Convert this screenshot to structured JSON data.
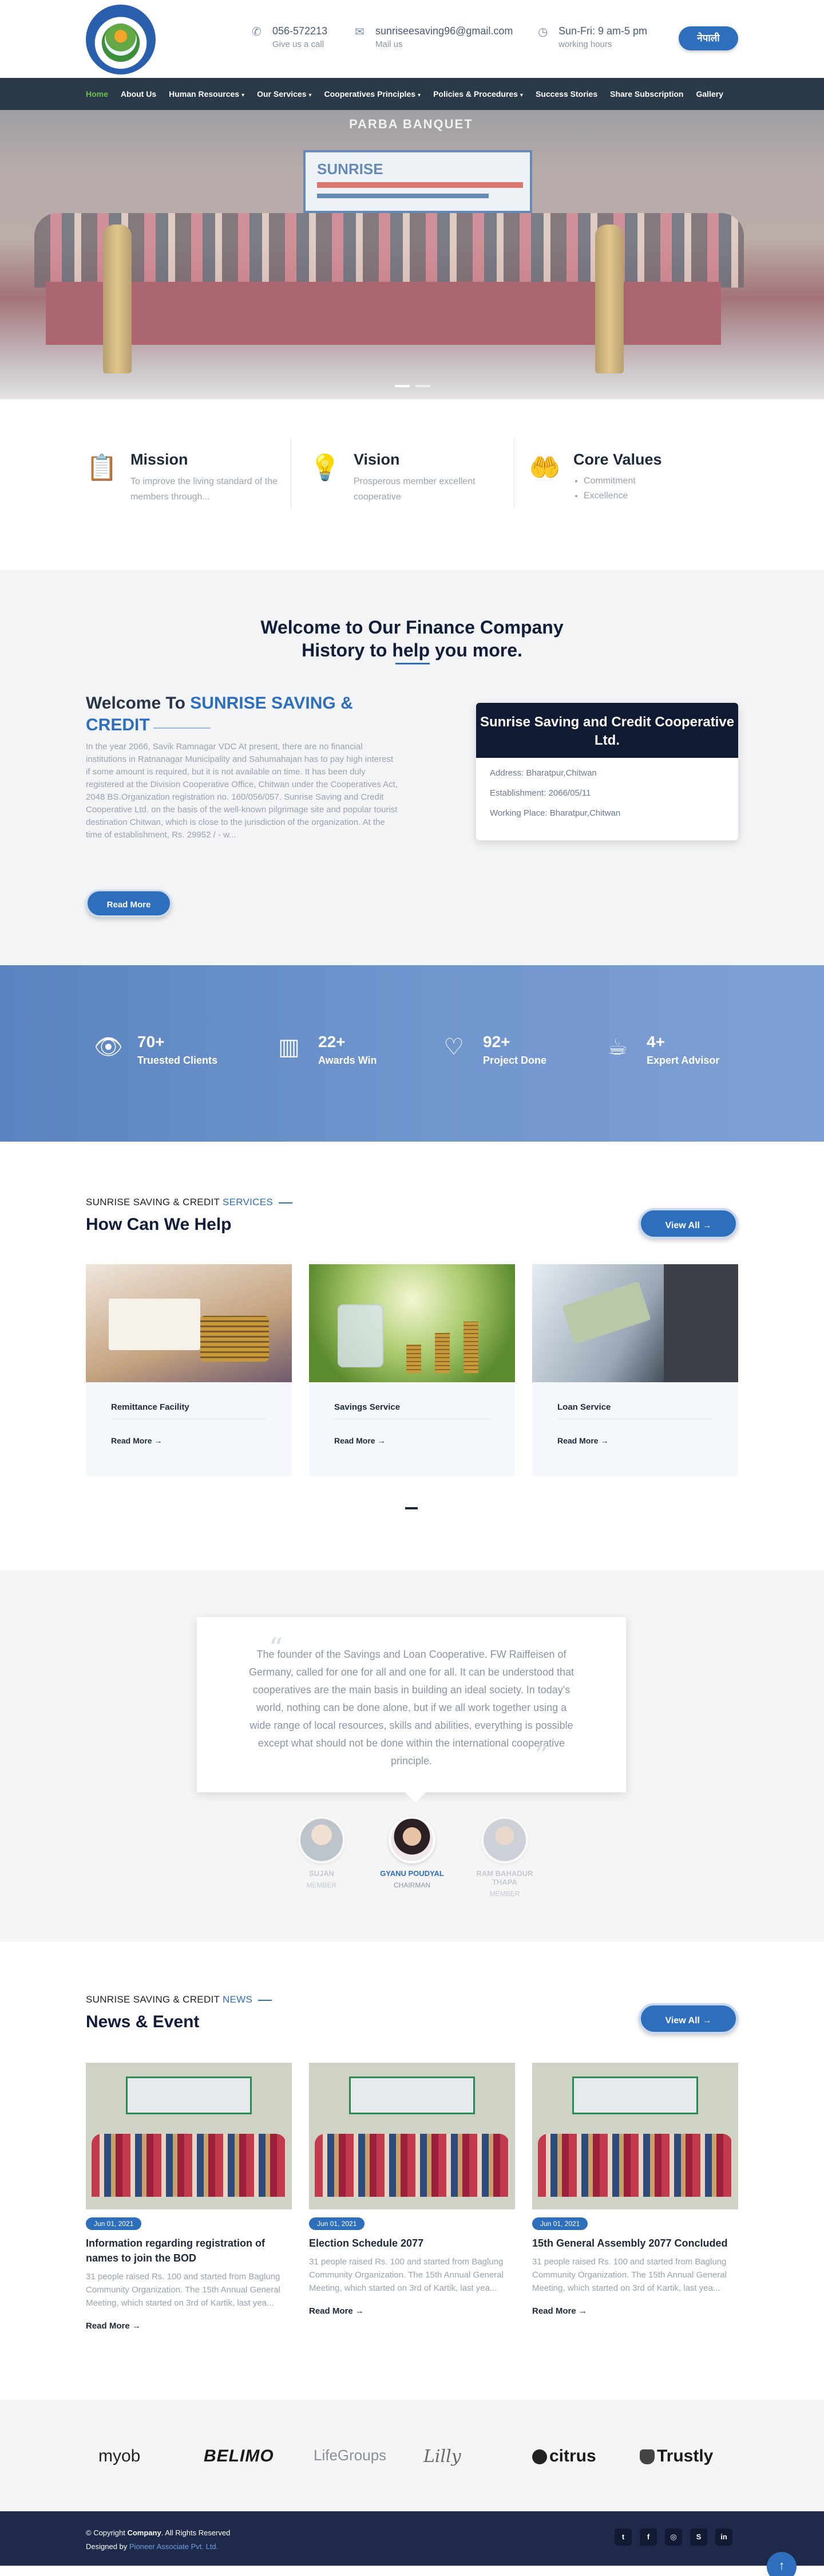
{
  "header": {
    "phone": {
      "icon": "phone-icon",
      "title": "056-572213",
      "sub": "Give us a call"
    },
    "email": {
      "icon": "mail-icon",
      "title": "sunriseesaving96@gmail.com",
      "sub": "Mail us"
    },
    "hours": {
      "icon": "clock-icon",
      "title": "Sun-Fri: 9 am-5 pm",
      "sub": "working hours"
    },
    "lang_button": "नेपाली"
  },
  "nav": {
    "items": [
      {
        "label": "Home",
        "dropdown": false,
        "active": true
      },
      {
        "label": "About Us",
        "dropdown": false
      },
      {
        "label": "Human Resources",
        "dropdown": true
      },
      {
        "label": "Our Services",
        "dropdown": true
      },
      {
        "label": "Cooperatives Principles",
        "dropdown": true
      },
      {
        "label": "Policies & Procedures",
        "dropdown": true
      },
      {
        "label": "Success Stories",
        "dropdown": false
      },
      {
        "label": "Share Subscription",
        "dropdown": false
      },
      {
        "label": "Gallery",
        "dropdown": false
      }
    ],
    "caret": "▾"
  },
  "hero": {
    "banner_text": "PARBA BANQUET",
    "banner_brand": "SUNRISE"
  },
  "features": {
    "mission": {
      "icon": "clipboard-icon",
      "title": "Mission",
      "text": "To improve the living standard of the members through..."
    },
    "vision": {
      "icon": "lightbulb-icon",
      "title": "Vision",
      "text": "Prosperous member excellent cooperative"
    },
    "values": {
      "icon": "hands-icon",
      "title": "Core Values",
      "list": [
        "Commitment",
        "Excellence"
      ]
    }
  },
  "about": {
    "heading_l1": "Welcome to Our Finance Company",
    "heading_l2": "History to help you more.",
    "sub_prefix": "Welcome To ",
    "sub_highlight": "SUNRISE SAVING & CREDIT",
    "body": "In the year 2066, Savik Ramnagar VDC At present, there are no financial institutions in Ratnanagar Municipality and Sahumahajan has to pay high interest if some amount is required, but it is not available on time. It has been duly registered at the Division Cooperative Office, Chitwan under the Cooperatives Act, 2048 BS.Organization registration no. 160/056/057. Sunrise Saving and Credit Cooperative Ltd. on the basis of the well-known pilgrimage site and popular tourist destination Chitwan, which is close to the jurisdiction of the organization. At the time of establishment, Rs. 29952 / - w...",
    "read_more": "Read More",
    "card": {
      "title": "Sunrise Saving and Credit Cooperative Ltd.",
      "address": "Address: Bharatpur,Chitwan",
      "established": "Establishment: 2066/05/11",
      "working_place": "Working Place: Bharatpur,Chitwan"
    }
  },
  "stats": [
    {
      "icon": "eye-icon",
      "value": "70+",
      "label": "Truested Clients"
    },
    {
      "icon": "bar-chart-icon",
      "value": "22+",
      "label": "Awards Win"
    },
    {
      "icon": "heart-icon",
      "value": "92+",
      "label": "Project Done"
    },
    {
      "icon": "coffee-icon",
      "value": "4+",
      "label": "Expert Advisor"
    }
  ],
  "services": {
    "kicker": "SUNRISE SAVING & CREDIT ",
    "kicker_hl": "SERVICES",
    "title": "How Can We Help",
    "view_all": "View All →",
    "items": [
      {
        "title": "Remittance Facility",
        "more": "Read More →"
      },
      {
        "title": "Savings Service",
        "more": "Read More →"
      },
      {
        "title": "Loan Service",
        "more": "Read More →"
      }
    ]
  },
  "testimonial": {
    "quote": "The founder of the Savings and Loan Cooperative. FW Raiffeisen of Germany, called for one for all and one for all. It can be understood that cooperatives are the main basis in building an ideal society. In today's world, nothing can be done alone, but if we all work together using a wide range of local resources, skills and abilities, everything is possible except what should not be done within the international cooperative principle.",
    "open_quote": "“",
    "close_quote": "”",
    "people": [
      {
        "name": "SUJAN",
        "role": "MEMBER"
      },
      {
        "name": "GYANU POUDYAL",
        "role": "CHAIRMAN"
      },
      {
        "name": "RAM BAHADUR THAPA",
        "role": "MEMBER"
      }
    ]
  },
  "news": {
    "kicker": "SUNRISE SAVING & CREDIT ",
    "kicker_hl": "NEWS",
    "title": "News & Event",
    "view_all": "View All →",
    "items": [
      {
        "date": "Jun 01, 2021",
        "title": "Information regarding registration of names to join the BOD",
        "text": "31 people raised Rs. 100 and started from Baglung Community Organization. The 15th Annual General Meeting, which started on 3rd of Kartik, last yea...",
        "more": "Read More →"
      },
      {
        "date": "Jun 01, 2021",
        "title": "Election Schedule 2077",
        "text": "31 people raised Rs. 100 and started from Baglung Community Organization. The 15th Annual General Meeting, which started on 3rd of Kartik, last yea...",
        "more": "Read More →"
      },
      {
        "date": "Jun 01, 2021",
        "title": "15th General Assembly 2077 Concluded",
        "text": "31 people raised Rs. 100 and started from Baglung Community Organization. The 15th Annual General Meeting, which started on 3rd of Kartik, last yea...",
        "more": "Read More →"
      }
    ]
  },
  "partners": [
    "myob",
    "BELIMO",
    "LifeGroups",
    "Lilly",
    "citrus",
    "Trustly"
  ],
  "footer": {
    "copyright_prefix": "© Copyright ",
    "company": "Company",
    "copyright_suffix": ". All Rights Reserved",
    "designed_prefix": "Designed by ",
    "designer": "Pioneer Associate Pvt. Ltd.",
    "social": [
      {
        "icon": "twitter-icon",
        "glyph": "t"
      },
      {
        "icon": "facebook-icon",
        "glyph": "f"
      },
      {
        "icon": "instagram-icon",
        "glyph": "◎"
      },
      {
        "icon": "skype-icon",
        "glyph": "S"
      },
      {
        "icon": "linkedin-icon",
        "glyph": "in"
      }
    ],
    "back_to_top": "↑"
  },
  "colors": {
    "accent": "#2d6fbd",
    "nav_bg": "#2b3a48",
    "nav_active": "#6cc04a",
    "footer_bg": "#1f2a4a"
  }
}
